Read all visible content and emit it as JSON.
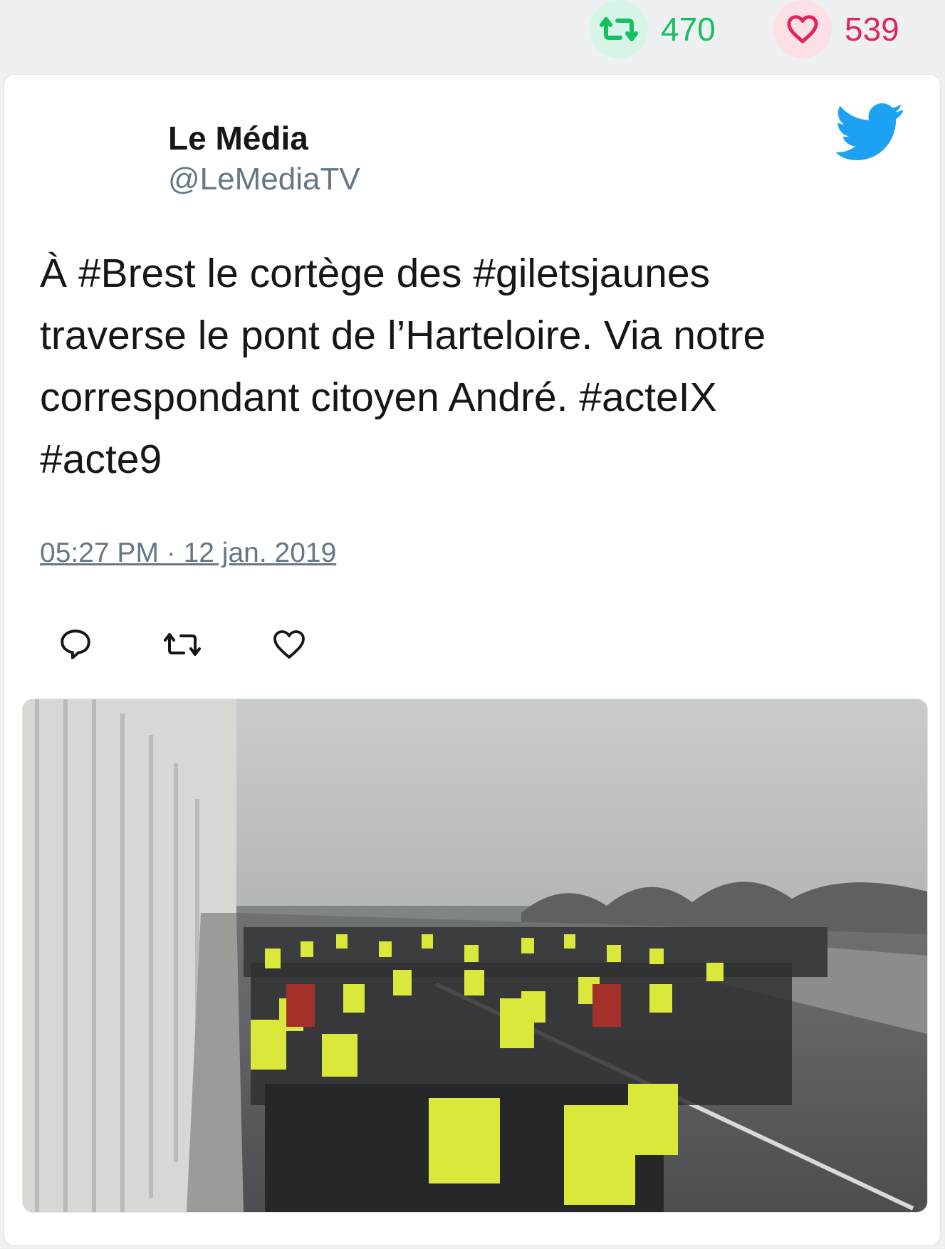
{
  "stats": {
    "retweet_count": "470",
    "like_count": "539",
    "retweet_icon": "retweet-icon",
    "like_icon": "heart-icon",
    "retweet_color": "#17bf63",
    "like_color": "#e0245e"
  },
  "tweet": {
    "author_name": "Le Média",
    "author_handle": "@LeMediaTV",
    "text": "À #Brest le cortège des #giletsjaunes\ntraverse le pont de l’Harteloire. Via notre\ncorrespondant citoyen André. #acteIX\n#acte9",
    "timestamp": "05:27 PM · 12 jan. 2019",
    "brand_icon": "twitter-bird-icon",
    "brand_color": "#1da1f2"
  },
  "actions": {
    "icons": [
      "reply-icon",
      "retweet-icon",
      "heart-icon"
    ]
  },
  "media": {
    "type": "photo",
    "subject": "yellow-vest protest march crossing a bridge"
  }
}
